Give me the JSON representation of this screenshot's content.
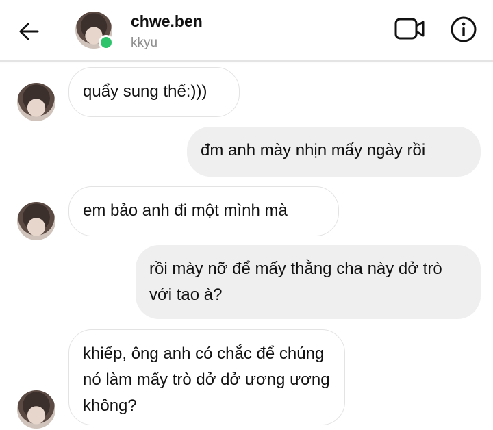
{
  "header": {
    "back_icon": "arrow-left-icon",
    "name": "chwe.ben",
    "username": "kkyu",
    "online_color": "#2ec46b",
    "video_icon": "video-camera-icon",
    "info_icon": "info-circle-icon"
  },
  "messages": [
    {
      "from": "them",
      "text": "quẩy sung thế:)))"
    },
    {
      "from": "me",
      "text": "đm anh mày nhịn mấy ngày rồi"
    },
    {
      "from": "them",
      "text": "em bảo anh đi một mình mà"
    },
    {
      "from": "me",
      "text": "rồi mày nỡ để mấy thằng cha này dở trò với tao à?"
    },
    {
      "from": "them",
      "text": "khiếp, ông anh có chắc để chúng nó làm mấy trò dở dở ương ương không?"
    }
  ]
}
